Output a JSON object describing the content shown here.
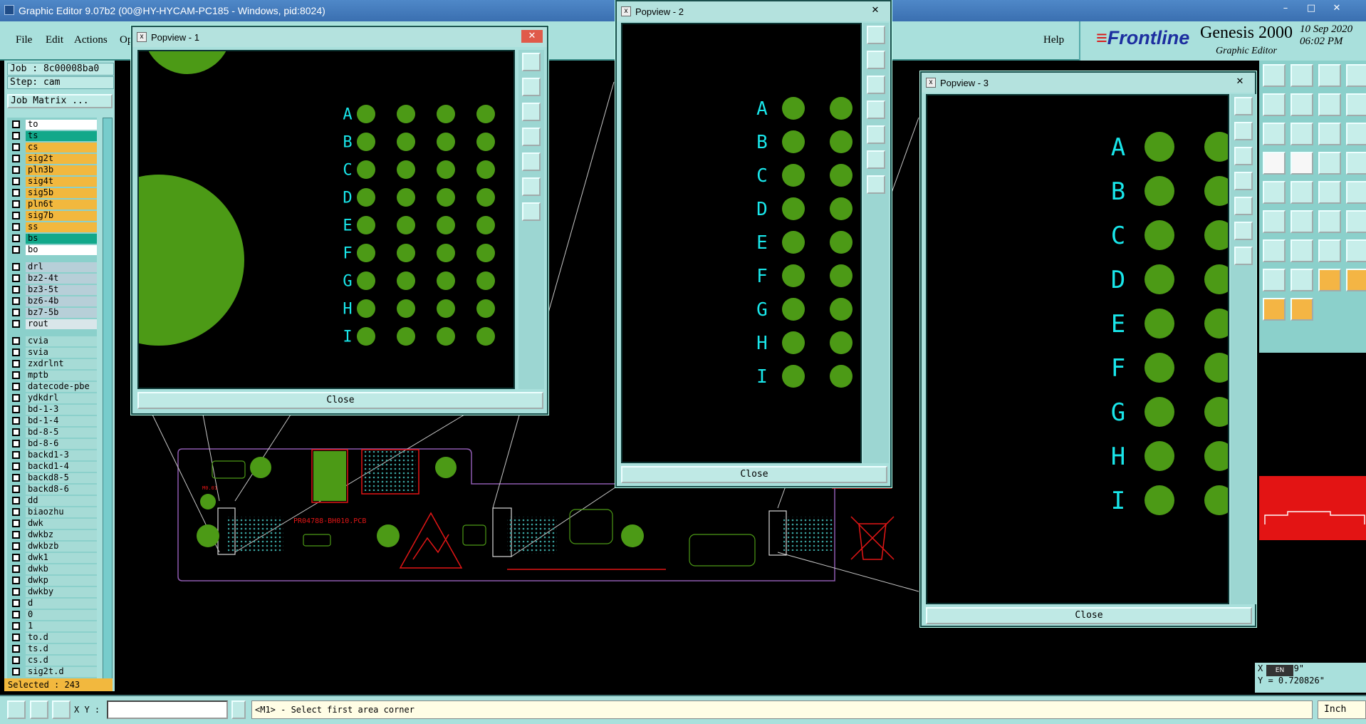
{
  "window": {
    "title": "Graphic Editor 9.07b2 (00@HY-HYCAM-PC185 - Windows, pid:8024)",
    "minimize": "–",
    "maximize": "□",
    "close": "✕"
  },
  "menu": {
    "file": "File",
    "edit": "Edit",
    "actions": "Actions",
    "options": "Op",
    "help": "Help"
  },
  "brand": {
    "logo_prefix": "≡",
    "logo_name": "Frontline",
    "product": "Genesis 2000",
    "subtitle": "Graphic Editor",
    "date": "10 Sep 2020",
    "time": "06:02 PM"
  },
  "job": {
    "job_label": "Job : 8c00008ba0",
    "step_label": "Step: cam",
    "matrix_button": "Job Matrix ..."
  },
  "layers": [
    "to",
    "ts",
    "cs",
    "sig2t",
    "pln3b",
    "sig4t",
    "sig5b",
    "pln6t",
    "sig7b",
    "ss",
    "bs",
    "bo",
    "drl",
    "bz2-4t",
    "bz3-5t",
    "bz6-4b",
    "bz7-5b",
    "rout",
    "cvia",
    "svia",
    "zxdrlnt",
    "mptb",
    "datecode-pbe",
    "ydkdrl",
    "bd-1-3",
    "bd-1-4",
    "bd-8-5",
    "bd-8-6",
    "backd1-3",
    "backd1-4",
    "backd8-5",
    "backd8-6",
    "dd",
    "biaozhu",
    "dwk",
    "dwkbz",
    "dwkbzb",
    "dwk1",
    "dwkb",
    "dwkp",
    "dwkby",
    "d",
    "0",
    "1",
    "to.d",
    "ts.d",
    "cs.d",
    "sig2t.d"
  ],
  "layer_colors": [
    "#ffffff",
    "#12a88a",
    "#f2b83e",
    "#f2b83e",
    "#f2b83e",
    "#f2b83e",
    "#f2b83e",
    "#f2b83e",
    "#f2b83e",
    "#f2b83e",
    "#12a88a",
    "#ffffff",
    "#b7cfd8",
    "#b7cfd8",
    "#b7cfd8",
    "#b7cfd8",
    "#b7cfd8",
    "#d9e6ea",
    "#a6dbd6",
    "#a6dbd6",
    "#a6dbd6",
    "#a6dbd6",
    "#a6dbd6",
    "#a6dbd6",
    "#a6dbd6",
    "#a6dbd6",
    "#a6dbd6",
    "#a6dbd6",
    "#a6dbd6",
    "#a6dbd6",
    "#a6dbd6",
    "#a6dbd6",
    "#a6dbd6",
    "#a6dbd6",
    "#a6dbd6",
    "#a6dbd6",
    "#a6dbd6",
    "#a6dbd6",
    "#a6dbd6",
    "#a6dbd6",
    "#a6dbd6",
    "#a6dbd6",
    "#a6dbd6",
    "#a6dbd6",
    "#a6dbd6",
    "#a6dbd6",
    "#a6dbd6",
    "#a6dbd6"
  ],
  "selected": "Selected : 243",
  "popups": {
    "p1": {
      "title": "Popview - 1",
      "close": "Close"
    },
    "p2": {
      "title": "Popview - 2",
      "close": "Close"
    },
    "p3": {
      "title": "Popview - 3",
      "close": "Close"
    }
  },
  "pad_labels": [
    "A",
    "B",
    "C",
    "D",
    "E",
    "F",
    "G",
    "H",
    "I"
  ],
  "board": {
    "label": "PR04788-BH010.PCB",
    "marker": "M0.01"
  },
  "status": {
    "xy_label": "X Y :",
    "coordinate_value": "",
    "message": "<M1> - Select first area corner",
    "units": "Inch"
  },
  "cursor_readout": {
    "x": "X = 0.29\"",
    "y": "Y = 0.720826\""
  },
  "taskbar": {
    "lang": "EN"
  }
}
